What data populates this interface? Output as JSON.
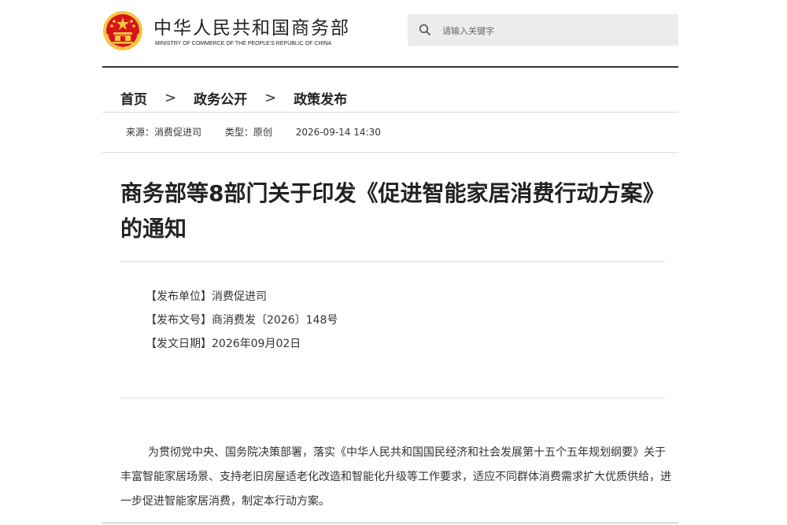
{
  "header": {
    "site_title": "中华人民共和国商务部",
    "site_subtitle": "MINISTRY OF COMMERCE OF THE PEOPLE'S REPUBLIC OF CHINA",
    "search_placeholder": "请输入关键字"
  },
  "breadcrumb": {
    "items": [
      "首页",
      "政务公开",
      "政策发布"
    ],
    "separator": ">"
  },
  "meta": {
    "source": "来源：消费促进司",
    "type": "类型：原创",
    "datetime": "2026-09-14 14:30"
  },
  "article": {
    "title": "商务部等8部门关于印发《促进智能家居消费行动方案》的通知",
    "info": {
      "issuer": "【发布单位】消费促进司",
      "doc_number": "【发布文号】商消费发〔2026〕148号",
      "issue_date": "【发文日期】2026年09月02日"
    },
    "paragraph": "为贯彻党中央、国务院决策部署，落实《中华人民共和国国民经济和社会发展第十五个五年规划纲要》关于丰富智能家居场景、支持老旧房屋适老化改造和智能化升级等工作要求，适应不同群体消费需求扩大优质供给，进一步促进智能家居消费，制定本行动方案。"
  },
  "colors": {
    "emblem_red": "#d7141a",
    "emblem_gold": "#f5c542",
    "search_bg": "#ececec",
    "text": "#333333"
  }
}
